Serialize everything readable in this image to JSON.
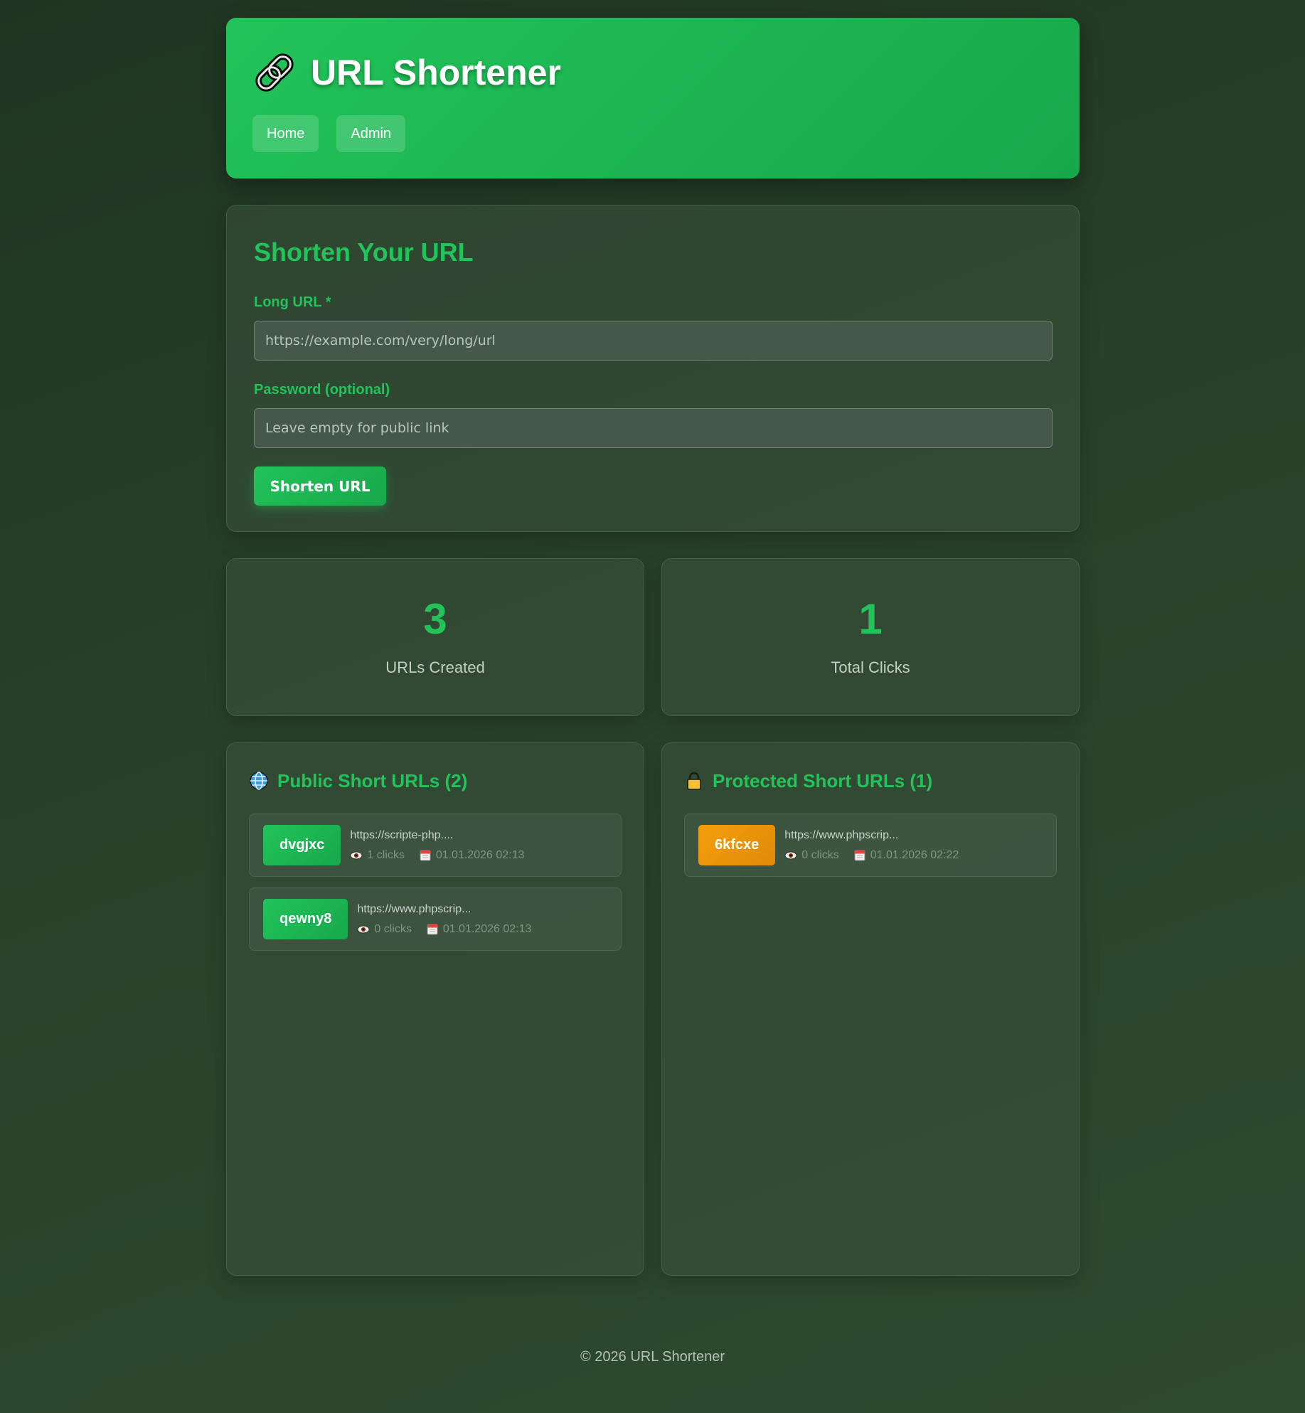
{
  "header": {
    "title": "URL Shortener",
    "nav": [
      "Home",
      "Admin"
    ]
  },
  "form": {
    "title": "Shorten Your URL",
    "long_url_label": "Long URL *",
    "long_url_placeholder": "https://example.com/very/long/url",
    "password_label": "Password (optional)",
    "password_placeholder": "Leave empty for public link",
    "submit_label": "Shorten URL"
  },
  "stats": [
    {
      "value": "3",
      "label": "URLs Created"
    },
    {
      "value": "1",
      "label": "Total Clicks"
    }
  ],
  "public_list": {
    "title": "Public Short URLs (2)",
    "icon": "globe-icon",
    "items": [
      {
        "code": "dvgjxc",
        "url": "https://scripte-php....",
        "clicks": "1 clicks",
        "date": "01.01.2026 02:13"
      },
      {
        "code": "qewny8",
        "url": "https://www.phpscrip...",
        "clicks": "0 clicks",
        "date": "01.01.2026 02:13"
      }
    ]
  },
  "protected_list": {
    "title": "Protected Short URLs (1)",
    "icon": "lock-icon",
    "items": [
      {
        "code": "6kfcxe",
        "url": "https://www.phpscrip...",
        "clicks": "0 clicks",
        "date": "01.01.2026 02:22"
      }
    ]
  },
  "footer": "© 2026 URL Shortener",
  "colors": {
    "accent": "#22c35a",
    "protected": "#f59e0b"
  }
}
